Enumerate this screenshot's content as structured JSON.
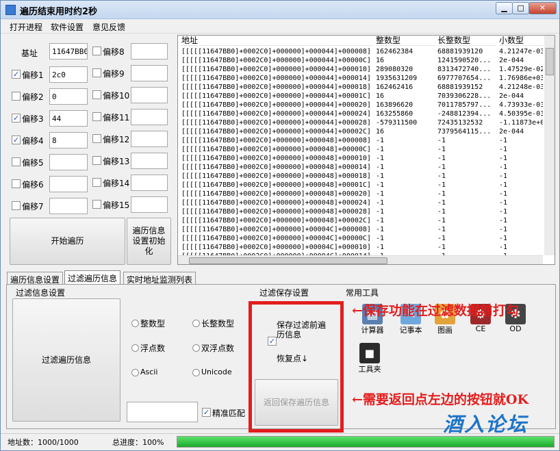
{
  "window": {
    "title": "遍历结束用时约2秒",
    "min_glyph": "▁",
    "max_glyph": "□",
    "close_glyph": "✕"
  },
  "menu": [
    "打开进程",
    "软件设置",
    "意见反馈"
  ],
  "left": {
    "base_label": "基址",
    "base_value": "11647BB0",
    "offsets": [
      {
        "label": "偏移1",
        "checked": true,
        "value": "2c0"
      },
      {
        "label": "偏移2",
        "checked": false,
        "value": "0"
      },
      {
        "label": "偏移3",
        "checked": true,
        "value": "44"
      },
      {
        "label": "偏移4",
        "checked": true,
        "value": "8"
      },
      {
        "label": "偏移5",
        "checked": false,
        "value": ""
      },
      {
        "label": "偏移6",
        "checked": false,
        "value": ""
      },
      {
        "label": "偏移7",
        "checked": false,
        "value": ""
      }
    ],
    "offsets_right": [
      {
        "label": "偏移8",
        "checked": false,
        "value": ""
      },
      {
        "label": "偏移9",
        "checked": false,
        "value": ""
      },
      {
        "label": "偏移10",
        "checked": false,
        "value": ""
      },
      {
        "label": "偏移11",
        "checked": false,
        "value": ""
      },
      {
        "label": "偏移12",
        "checked": false,
        "value": ""
      },
      {
        "label": "偏移13",
        "checked": false,
        "value": ""
      },
      {
        "label": "偏移14",
        "checked": false,
        "value": ""
      },
      {
        "label": "偏移15",
        "checked": false,
        "value": ""
      }
    ],
    "start_button": "开始遍历",
    "init_button": "遍历信息设置初始化"
  },
  "grid": {
    "columns": [
      "地址",
      "整数型",
      "长整数型",
      "小数型"
    ],
    "rows": [
      [
        "[[[[[11647BB0]+0002C0]+000000]+000044]+000008]",
        "162462384",
        "68881939120",
        "4.21247e-03"
      ],
      [
        "[[[[[11647BB0]+0002C0]+000000]+000044]+00000C]",
        "16",
        "1241590520...",
        "2e-044"
      ],
      [
        "[[[[[11647BB0]+0002C0]+000000]+000044]+000010]",
        "289080320",
        "8313472740...",
        "1.47529e-02"
      ],
      [
        "[[[[[11647BB0]+0002C0]+000000]+000044]+000014]",
        "1935631209",
        "6977707654...",
        "1.76986e+03"
      ],
      [
        "[[[[[11647BB0]+0002C0]+000000]+000044]+000018]",
        "162462416",
        "68881939152",
        "4.21248e-03"
      ],
      [
        "[[[[[11647BB0]+0002C0]+000000]+000044]+00001C]",
        "16",
        "7039306228...",
        "2e-044"
      ],
      [
        "[[[[[11647BB0]+0002C0]+000000]+000044]+000020]",
        "163896620",
        "7011785797...",
        "4.73933e-03"
      ],
      [
        "[[[[[11647BB0]+0002C0]+000000]+000044]+000024]",
        "163255860",
        "-248812394...",
        "4.50395e-03"
      ],
      [
        "[[[[[11647BB0]+0002C0]+000000]+000044]+000028]",
        "-579311500",
        "72435132532",
        "-1.11873e+0"
      ],
      [
        "[[[[[11647BB0]+0002C0]+000000]+000044]+00002C]",
        "16",
        "7379564115...",
        "2e-044"
      ],
      [
        "[[[[[11647BB0]+0002C0]+000000]+000048]+000008]",
        "-1",
        "-1",
        "-1"
      ],
      [
        "[[[[[11647BB0]+0002C0]+000000]+000048]+00000C]",
        "-1",
        "-1",
        "-1"
      ],
      [
        "[[[[[11647BB0]+0002C0]+000000]+000048]+000010]",
        "-1",
        "-1",
        "-1"
      ],
      [
        "[[[[[11647BB0]+0002C0]+000000]+000048]+000014]",
        "-1",
        "-1",
        "-1"
      ],
      [
        "[[[[[11647BB0]+0002C0]+000000]+000048]+000018]",
        "-1",
        "-1",
        "-1"
      ],
      [
        "[[[[[11647BB0]+0002C0]+000000]+000048]+00001C]",
        "-1",
        "-1",
        "-1"
      ],
      [
        "[[[[[11647BB0]+0002C0]+000000]+000048]+000020]",
        "-1",
        "-1",
        "-1"
      ],
      [
        "[[[[[11647BB0]+0002C0]+000000]+000048]+000024]",
        "-1",
        "-1",
        "-1"
      ],
      [
        "[[[[[11647BB0]+0002C0]+000000]+000048]+000028]",
        "-1",
        "-1",
        "-1"
      ],
      [
        "[[[[[11647BB0]+0002C0]+000000]+000048]+00002C]",
        "-1",
        "-1",
        "-1"
      ],
      [
        "[[[[[11647BB0]+0002C0]+000000]+00004C]+000008]",
        "-1",
        "-1",
        "-1"
      ],
      [
        "[[[[[11647BB0]+0002C0]+000000]+00004C]+00000C]",
        "-1",
        "-1",
        "-1"
      ],
      [
        "[[[[[11647BB0]+0002C0]+000000]+00004C]+000010]",
        "-1",
        "-1",
        "-1"
      ],
      [
        "[[[[[11647BB0]+0002C0]+000000]+00004C]+000014]",
        "-1",
        "-1",
        "-1"
      ]
    ]
  },
  "tabs": [
    "遍历信息设置",
    "过滤遍历信息",
    "实时地址监测列表"
  ],
  "active_tab": 1,
  "filter": {
    "section_title": "过滤信息设置",
    "filter_button": "过滤遍历信息",
    "radios": [
      "整数型",
      "长整数型",
      "浮点数",
      "双浮点数",
      "Ascii",
      "Unicode"
    ],
    "search_value": "",
    "exact_label": "精准匹配",
    "exact_checked": true
  },
  "save": {
    "section_title": "过滤保存设置",
    "save_label": "保存过滤前遍历信息",
    "save_checked": true,
    "restore_label": "恢复点↓",
    "return_button": "返回保存遍历信息"
  },
  "tools": {
    "section_title": "常用工具",
    "items": [
      "计算器",
      "记事本",
      "图画",
      "CE",
      "OD",
      "工具夹"
    ],
    "icons": [
      "calculator-icon",
      "notepad-icon",
      "paint-icon",
      "ce-icon",
      "od-icon",
      "toolbox-icon"
    ]
  },
  "annotations": {
    "top": "←保存功能在过滤数据前打勾",
    "bottom": "←需要返回点左边的按钮就OK"
  },
  "status": {
    "address_count": "地址数：1000/1000",
    "progress_label": "总进度：100%",
    "progress": 1.0
  },
  "watermark": "酒入论坛",
  "colors": {
    "accent": "#e41d1d",
    "progress": "#1ba92b",
    "watermark": "#1d74c9"
  }
}
